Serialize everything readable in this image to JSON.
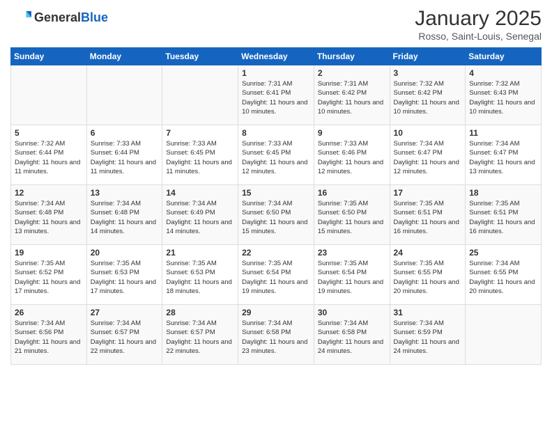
{
  "header": {
    "logo_general": "General",
    "logo_blue": "Blue",
    "month_year": "January 2025",
    "location": "Rosso, Saint-Louis, Senegal"
  },
  "days_of_week": [
    "Sunday",
    "Monday",
    "Tuesday",
    "Wednesday",
    "Thursday",
    "Friday",
    "Saturday"
  ],
  "weeks": [
    [
      {
        "day": "",
        "info": ""
      },
      {
        "day": "",
        "info": ""
      },
      {
        "day": "",
        "info": ""
      },
      {
        "day": "1",
        "info": "Sunrise: 7:31 AM\nSunset: 6:41 PM\nDaylight: 11 hours and 10 minutes."
      },
      {
        "day": "2",
        "info": "Sunrise: 7:31 AM\nSunset: 6:42 PM\nDaylight: 11 hours and 10 minutes."
      },
      {
        "day": "3",
        "info": "Sunrise: 7:32 AM\nSunset: 6:42 PM\nDaylight: 11 hours and 10 minutes."
      },
      {
        "day": "4",
        "info": "Sunrise: 7:32 AM\nSunset: 6:43 PM\nDaylight: 11 hours and 10 minutes."
      }
    ],
    [
      {
        "day": "5",
        "info": "Sunrise: 7:32 AM\nSunset: 6:44 PM\nDaylight: 11 hours and 11 minutes."
      },
      {
        "day": "6",
        "info": "Sunrise: 7:33 AM\nSunset: 6:44 PM\nDaylight: 11 hours and 11 minutes."
      },
      {
        "day": "7",
        "info": "Sunrise: 7:33 AM\nSunset: 6:45 PM\nDaylight: 11 hours and 11 minutes."
      },
      {
        "day": "8",
        "info": "Sunrise: 7:33 AM\nSunset: 6:45 PM\nDaylight: 11 hours and 12 minutes."
      },
      {
        "day": "9",
        "info": "Sunrise: 7:33 AM\nSunset: 6:46 PM\nDaylight: 11 hours and 12 minutes."
      },
      {
        "day": "10",
        "info": "Sunrise: 7:34 AM\nSunset: 6:47 PM\nDaylight: 11 hours and 12 minutes."
      },
      {
        "day": "11",
        "info": "Sunrise: 7:34 AM\nSunset: 6:47 PM\nDaylight: 11 hours and 13 minutes."
      }
    ],
    [
      {
        "day": "12",
        "info": "Sunrise: 7:34 AM\nSunset: 6:48 PM\nDaylight: 11 hours and 13 minutes."
      },
      {
        "day": "13",
        "info": "Sunrise: 7:34 AM\nSunset: 6:48 PM\nDaylight: 11 hours and 14 minutes."
      },
      {
        "day": "14",
        "info": "Sunrise: 7:34 AM\nSunset: 6:49 PM\nDaylight: 11 hours and 14 minutes."
      },
      {
        "day": "15",
        "info": "Sunrise: 7:34 AM\nSunset: 6:50 PM\nDaylight: 11 hours and 15 minutes."
      },
      {
        "day": "16",
        "info": "Sunrise: 7:35 AM\nSunset: 6:50 PM\nDaylight: 11 hours and 15 minutes."
      },
      {
        "day": "17",
        "info": "Sunrise: 7:35 AM\nSunset: 6:51 PM\nDaylight: 11 hours and 16 minutes."
      },
      {
        "day": "18",
        "info": "Sunrise: 7:35 AM\nSunset: 6:51 PM\nDaylight: 11 hours and 16 minutes."
      }
    ],
    [
      {
        "day": "19",
        "info": "Sunrise: 7:35 AM\nSunset: 6:52 PM\nDaylight: 11 hours and 17 minutes."
      },
      {
        "day": "20",
        "info": "Sunrise: 7:35 AM\nSunset: 6:53 PM\nDaylight: 11 hours and 17 minutes."
      },
      {
        "day": "21",
        "info": "Sunrise: 7:35 AM\nSunset: 6:53 PM\nDaylight: 11 hours and 18 minutes."
      },
      {
        "day": "22",
        "info": "Sunrise: 7:35 AM\nSunset: 6:54 PM\nDaylight: 11 hours and 19 minutes."
      },
      {
        "day": "23",
        "info": "Sunrise: 7:35 AM\nSunset: 6:54 PM\nDaylight: 11 hours and 19 minutes."
      },
      {
        "day": "24",
        "info": "Sunrise: 7:35 AM\nSunset: 6:55 PM\nDaylight: 11 hours and 20 minutes."
      },
      {
        "day": "25",
        "info": "Sunrise: 7:34 AM\nSunset: 6:55 PM\nDaylight: 11 hours and 20 minutes."
      }
    ],
    [
      {
        "day": "26",
        "info": "Sunrise: 7:34 AM\nSunset: 6:56 PM\nDaylight: 11 hours and 21 minutes."
      },
      {
        "day": "27",
        "info": "Sunrise: 7:34 AM\nSunset: 6:57 PM\nDaylight: 11 hours and 22 minutes."
      },
      {
        "day": "28",
        "info": "Sunrise: 7:34 AM\nSunset: 6:57 PM\nDaylight: 11 hours and 22 minutes."
      },
      {
        "day": "29",
        "info": "Sunrise: 7:34 AM\nSunset: 6:58 PM\nDaylight: 11 hours and 23 minutes."
      },
      {
        "day": "30",
        "info": "Sunrise: 7:34 AM\nSunset: 6:58 PM\nDaylight: 11 hours and 24 minutes."
      },
      {
        "day": "31",
        "info": "Sunrise: 7:34 AM\nSunset: 6:59 PM\nDaylight: 11 hours and 24 minutes."
      },
      {
        "day": "",
        "info": ""
      }
    ]
  ]
}
